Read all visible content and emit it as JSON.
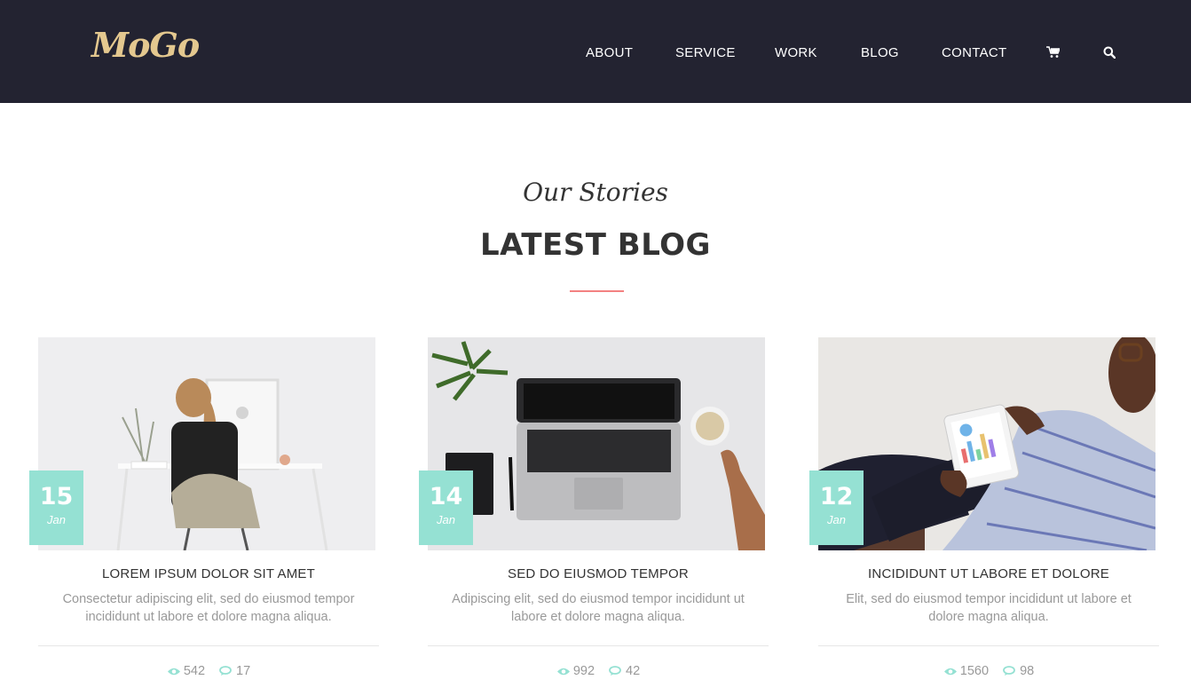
{
  "header": {
    "logo": "MoGo",
    "nav": [
      {
        "label": "ABOUT"
      },
      {
        "label": "SERVICE"
      },
      {
        "label": "WORK"
      },
      {
        "label": "BLOG"
      },
      {
        "label": "CONTACT"
      }
    ],
    "icons": [
      "cart-icon",
      "search-icon"
    ]
  },
  "section": {
    "subtitle": "Our Stories",
    "title": "LATEST BLOG",
    "accent_color": "#f38181"
  },
  "posts": [
    {
      "day": "15",
      "month": "Jan",
      "title": "LOREM IPSUM DOLOR SIT AMET",
      "text": "Consectetur adipiscing elit, sed do eiusmod tempor incididunt ut labore et dolore magna aliqua.",
      "views": "542",
      "comments": "17"
    },
    {
      "day": "14",
      "month": "Jan",
      "title": "SED DO EIUSMOD TEMPOR",
      "text": "Adipiscing elit, sed do eiusmod tempor incididunt ut labore et dolore magna aliqua.",
      "views": "992",
      "comments": "42"
    },
    {
      "day": "12",
      "month": "Jan",
      "title": "INCIDIDUNT UT LABORE ET DOLORE",
      "text": "Elit, sed do eiusmod tempor incididunt ut labore et dolore magna aliqua.",
      "views": "1560",
      "comments": "98"
    }
  ],
  "colors": {
    "header_bg": "#232331",
    "logo": "#e4c88f",
    "badge": "#95e1d3",
    "stat_icon": "#95e1d3"
  }
}
